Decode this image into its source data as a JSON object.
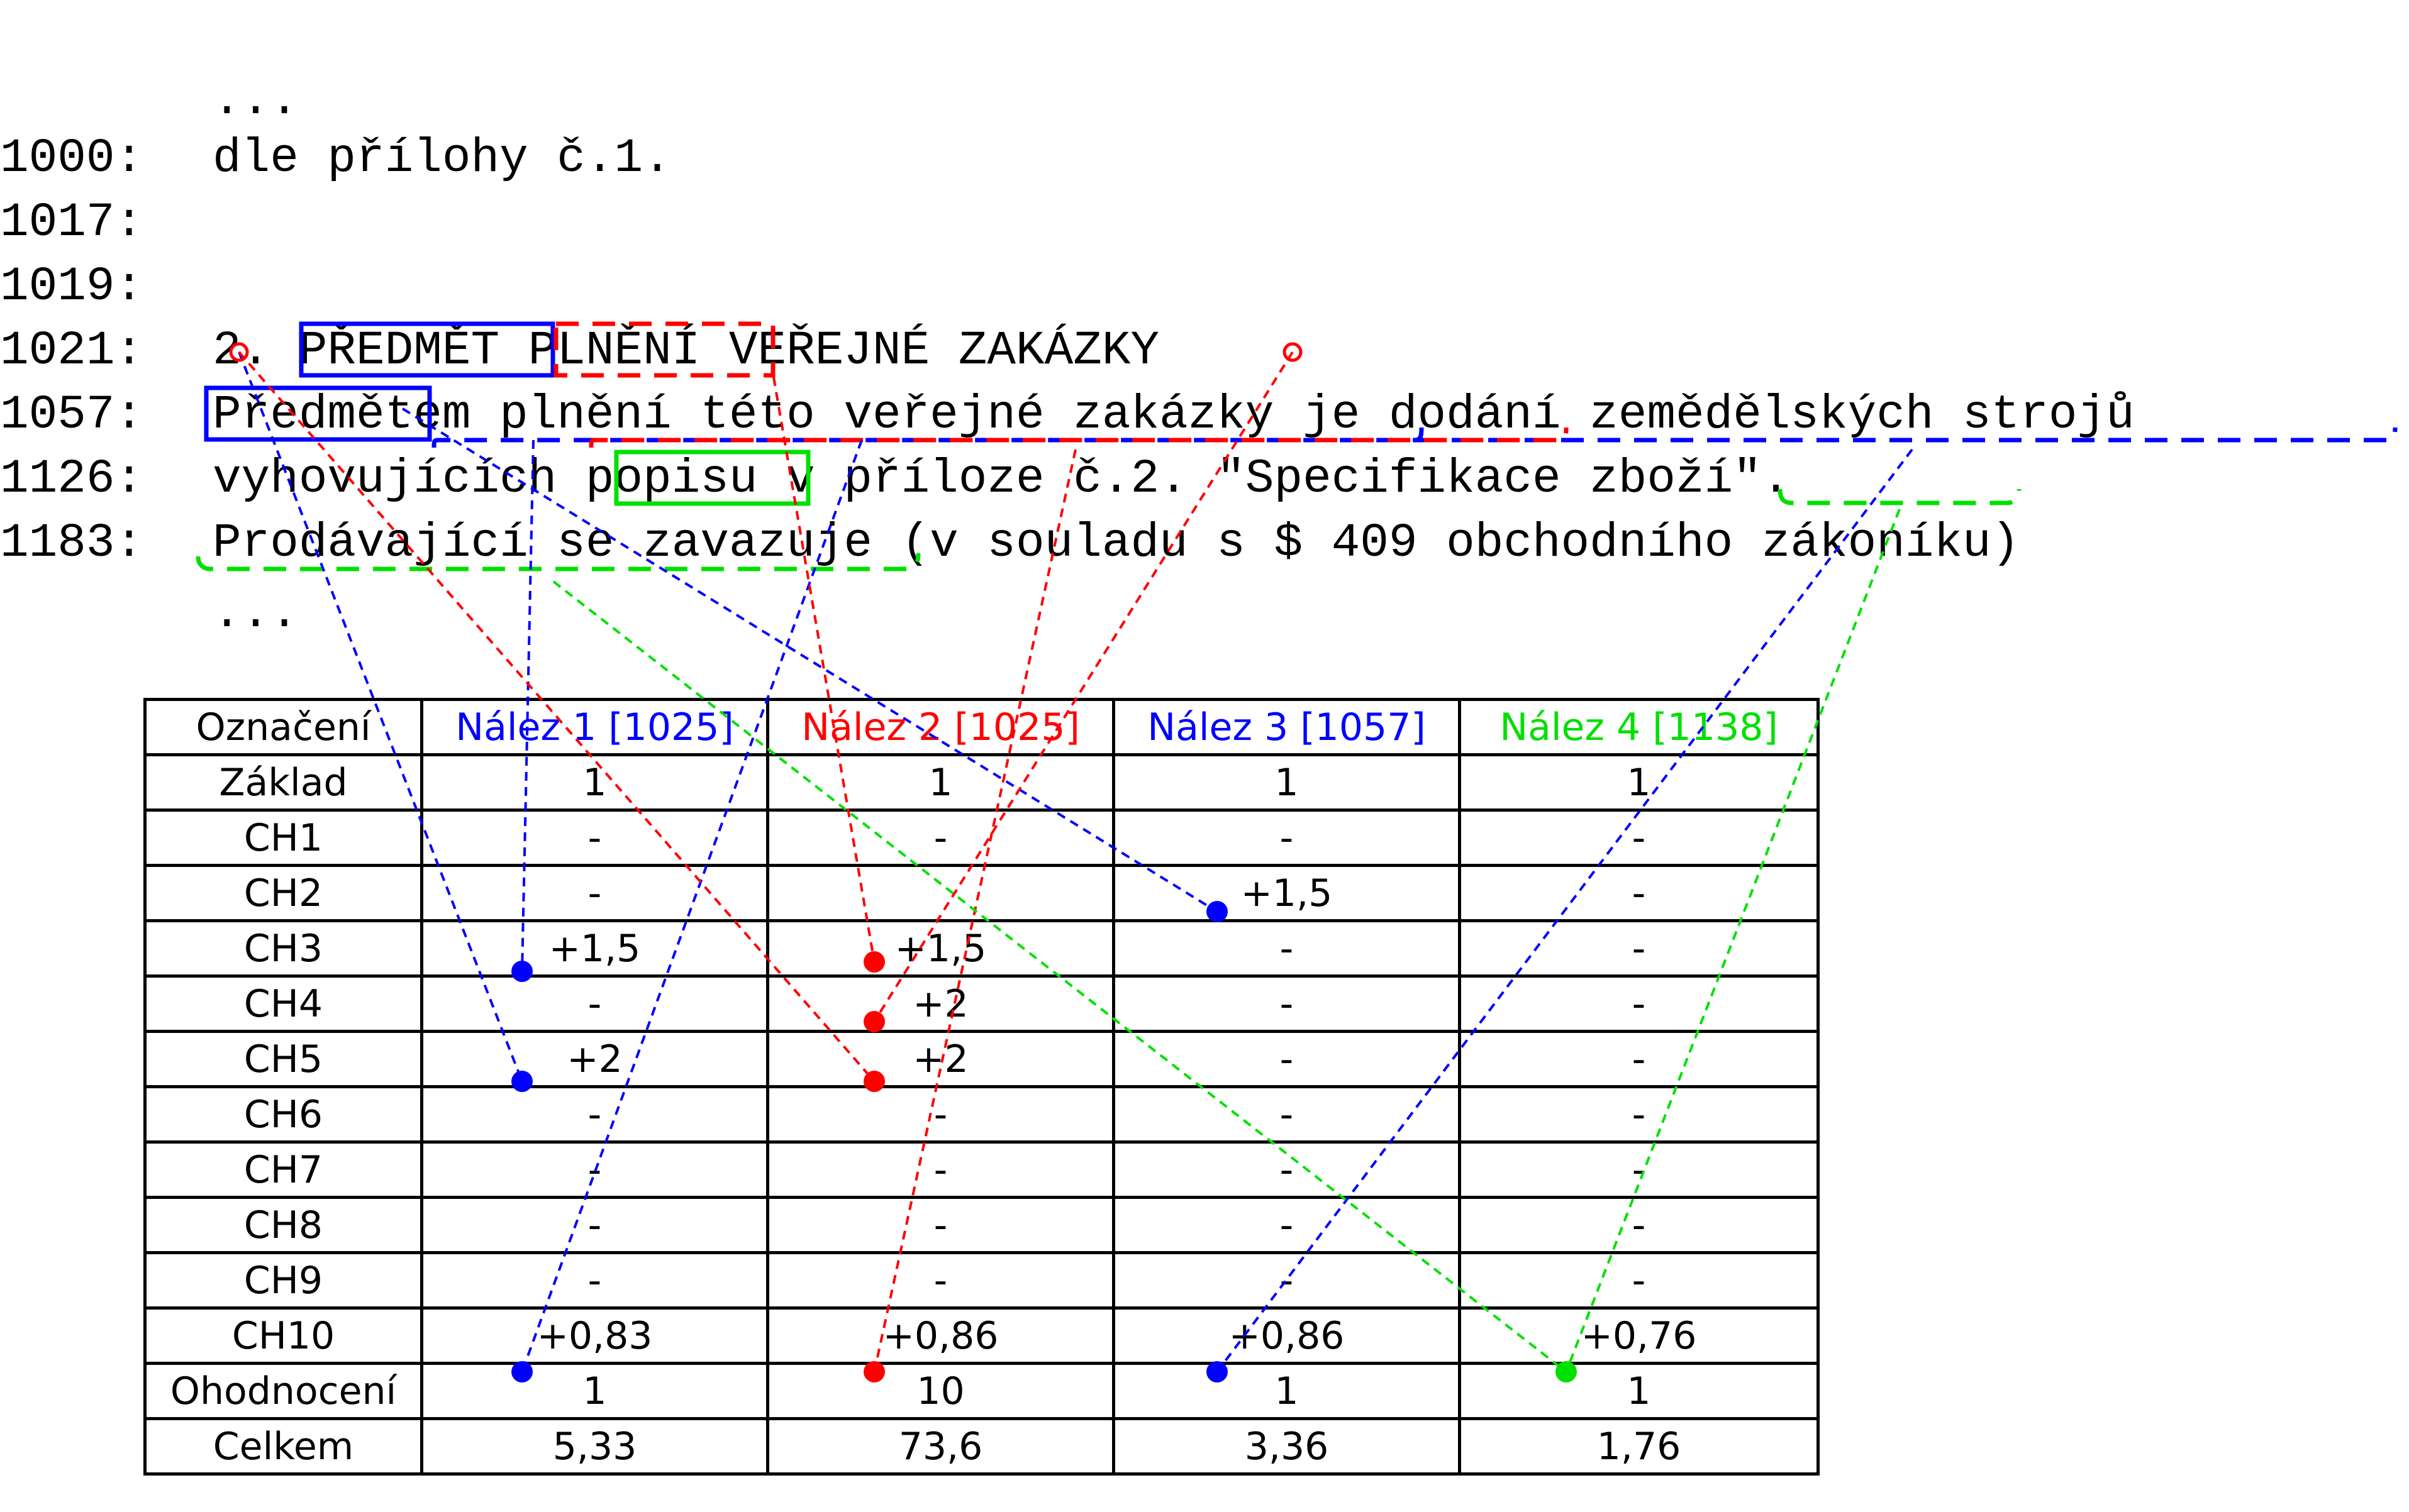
{
  "code_lines": [
    {
      "num": "",
      "text": "..."
    },
    {
      "num": "1000:",
      "text": "dle přílohy č.1."
    },
    {
      "num": "1017:",
      "text": ""
    },
    {
      "num": "1019:",
      "text": ""
    },
    {
      "num": "1021:",
      "text": "2. PŘEDMĚT PLNĚNÍ VEŘEJNÉ ZAKÁZKY"
    },
    {
      "num": "1057:",
      "text": "Předmětem plnění této veřejné zakázky je dodání zemědělských strojů"
    },
    {
      "num": "1126:",
      "text": "vyhovujících popisu v příloze č.2. \"Specifikace zboží\"."
    },
    {
      "num": "1183:",
      "text": "Prodávající se zavazuje (v souladu s $ 409 obchodního zákoníku)"
    },
    {
      "num": "",
      "text": "..."
    }
  ],
  "table": {
    "headers": [
      "Označení",
      "Nález 1 [1025]",
      "Nález 2 [1025]",
      "Nález 3 [1057]",
      "Nález 4 [1138]"
    ],
    "header_colors": [
      "#000000",
      "#0000ff",
      "#ff0000",
      "#0000ff",
      "#00e000"
    ],
    "rows": [
      [
        "Základ",
        "1",
        "1",
        "1",
        "1"
      ],
      [
        "CH1",
        "-",
        "-",
        "-",
        "-"
      ],
      [
        "CH2",
        "-",
        "",
        "+1,5",
        "-"
      ],
      [
        "CH3",
        "+1,5",
        "+1,5",
        "-",
        "-"
      ],
      [
        "CH4",
        "-",
        "+2",
        "-",
        "-"
      ],
      [
        "CH5",
        "+2",
        "+2",
        "-",
        "-"
      ],
      [
        "CH6",
        "-",
        "-",
        "-",
        "-"
      ],
      [
        "CH7",
        "-",
        "-",
        "-",
        "-"
      ],
      [
        "CH8",
        "-",
        "-",
        "-",
        "-"
      ],
      [
        "CH9",
        "-",
        "-",
        "-",
        "-"
      ],
      [
        "CH10",
        "+0,83",
        "+0,86",
        "+0,86",
        "+0,76"
      ],
      [
        "Ohodnocení",
        "1",
        "10",
        "1",
        "1"
      ],
      [
        "Celkem",
        "5,33",
        "73,6",
        "3,36",
        "1,76"
      ]
    ]
  },
  "colors": {
    "blue": "#0000ff",
    "red": "#ff0000",
    "green": "#00e000",
    "black": "#000000"
  }
}
